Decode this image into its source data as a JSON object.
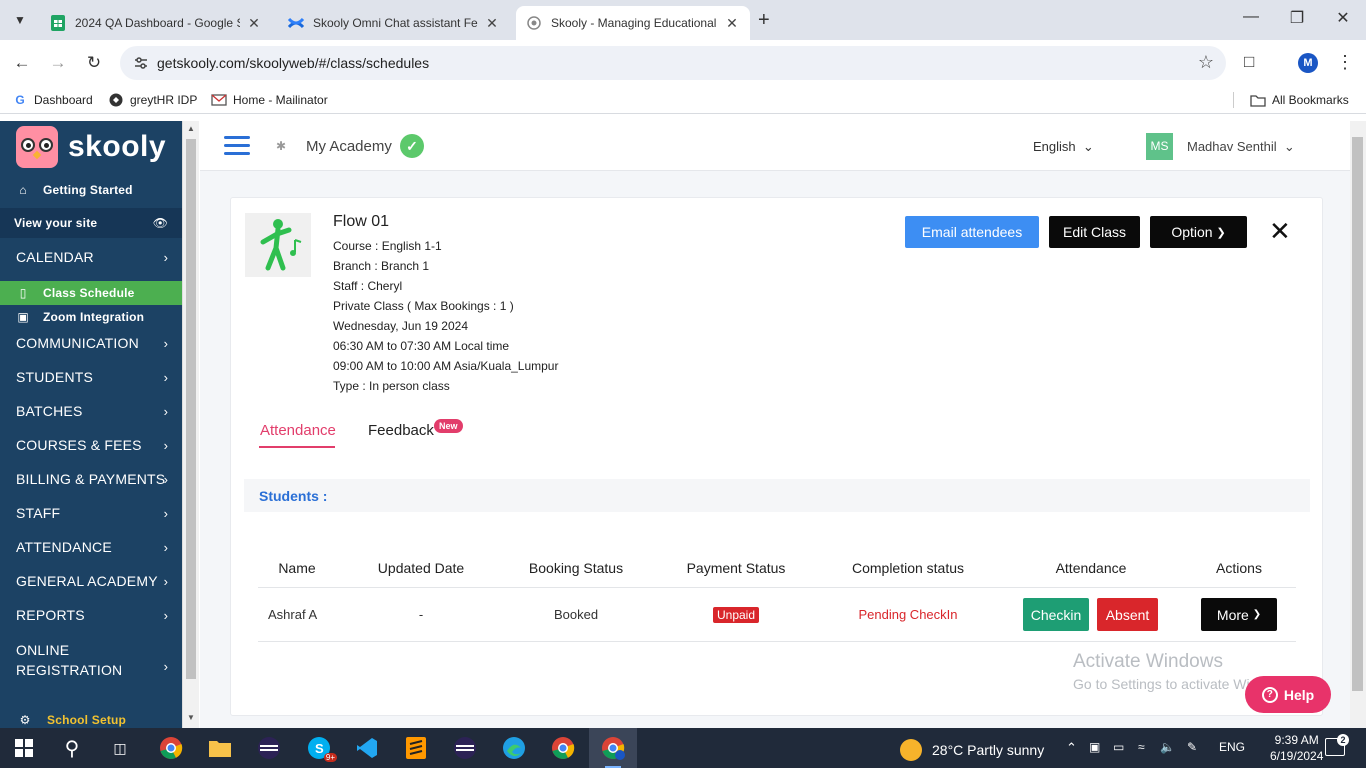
{
  "browser": {
    "tabs": [
      {
        "title": "2024 QA Dashboard - Google S",
        "icon": "sheets-icon"
      },
      {
        "title": "Skooly Omni Chat assistant Fea",
        "icon": "confluence-icon"
      },
      {
        "title": "Skooly - Managing Educational",
        "icon": "globe-icon"
      }
    ],
    "url": "getskooly.com/skoolyweb/#/class/schedules",
    "profile_initial": "M",
    "bookmarks": [
      {
        "label": "Dashboard",
        "icon": "google-icon"
      },
      {
        "label": "greytHR IDP",
        "icon": "greythr-icon"
      },
      {
        "label": "Home - Mailinator",
        "icon": "mail-icon"
      }
    ],
    "all_bookmarks": "All Bookmarks"
  },
  "sidebar": {
    "brand": "skooly",
    "items": [
      {
        "label": "Getting Started",
        "icon": "home-icon"
      },
      {
        "label": "View your site",
        "icon": "eye-icon"
      },
      {
        "label": "CALENDAR"
      },
      {
        "label": "Class Schedule",
        "icon": "bookmark-icon"
      },
      {
        "label": "Zoom Integration",
        "icon": "video-icon"
      },
      {
        "label": "COMMUNICATION"
      },
      {
        "label": "STUDENTS"
      },
      {
        "label": "BATCHES"
      },
      {
        "label": "COURSES & FEES"
      },
      {
        "label": "BILLING & PAYMENTS"
      },
      {
        "label": "STAFF"
      },
      {
        "label": "ATTENDANCE"
      },
      {
        "label": "GENERAL ACADEMY"
      },
      {
        "label": "REPORTS"
      },
      {
        "label": "ONLINE REGISTRATION"
      },
      {
        "label": "School Setup",
        "icon": "gear-icon"
      }
    ],
    "online_reg_line1": "ONLINE",
    "online_reg_line2": "REGISTRATION"
  },
  "header": {
    "academy": "My Academy",
    "language": "English",
    "user_initials": "MS",
    "user_name": "Madhav Senthil"
  },
  "class": {
    "title": "Flow 01",
    "course_label": "Course : ",
    "course": "English 1-1",
    "branch_label": "Branch : ",
    "branch": "Branch 1",
    "staff_label": "Staff : ",
    "staff": "Cheryl",
    "private": "Private Class ( Max Bookings : 1 )",
    "date": "Wednesday, Jun 19 2024",
    "local_time": "06:30 AM to 07:30 AM Local time",
    "tz_time": "09:00 AM to 10:00 AM Asia/Kuala_Lumpur",
    "type_label": "Type : ",
    "type": "In person class"
  },
  "actions": {
    "email": "Email attendees",
    "edit": "Edit Class",
    "option": "Option"
  },
  "tabs": {
    "attendance": "Attendance",
    "feedback": "Feedback",
    "new_badge": "New"
  },
  "students_label": "Students :",
  "table": {
    "headers": [
      "Name",
      "Updated Date",
      "Booking Status",
      "Payment Status",
      "Completion status",
      "Attendance",
      "Actions"
    ],
    "rows": [
      {
        "name": "Ashraf A",
        "updated": "-",
        "booking": "Booked",
        "payment": "Unpaid",
        "completion": "Pending CheckIn",
        "checkin": "Checkin",
        "absent": "Absent",
        "more": "More"
      }
    ]
  },
  "watermark": {
    "line1": "Activate Windows",
    "line2": "Go to Settings to activate Windows."
  },
  "help": "Help",
  "taskbar": {
    "weather": "28°C  Partly sunny",
    "lang": "ENG",
    "time": "9:39 AM",
    "date": "6/19/2024",
    "notif_count": "2",
    "skype_badge": "9+"
  },
  "colors": {
    "sidebar": "#1c4264",
    "sidebar_active": "#4caf50",
    "email_btn": "#3d8ef3",
    "checkin_btn": "#1e9e74",
    "absent_btn": "#d9262b",
    "accent_pink": "#e23d6b"
  }
}
